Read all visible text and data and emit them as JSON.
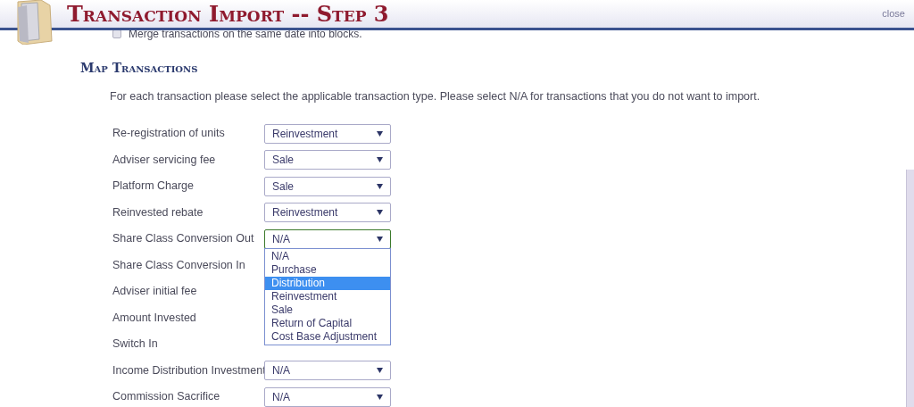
{
  "header": {
    "title": "Transaction Import -- Step 3",
    "close": "close"
  },
  "merge_option": {
    "label": "Merge transactions on the same date into blocks.",
    "checked": false
  },
  "section": {
    "heading": "Map Transactions",
    "instruction": "For each transaction please select the applicable transaction type. Please select N/A for transactions that you do not want to import."
  },
  "rows": [
    {
      "label": "Re-registration of units",
      "value": "Reinvestment",
      "open": false
    },
    {
      "label": "Adviser servicing fee",
      "value": "Sale",
      "open": false
    },
    {
      "label": "Platform Charge",
      "value": "Sale",
      "open": false
    },
    {
      "label": "Reinvested rebate",
      "value": "Reinvestment",
      "open": false
    },
    {
      "label": "Share Class Conversion Out",
      "value": "N/A",
      "open": true,
      "options": [
        {
          "label": "N/A",
          "highlighted": false
        },
        {
          "label": "Purchase",
          "highlighted": false
        },
        {
          "label": "Distribution",
          "highlighted": true
        },
        {
          "label": "Reinvestment",
          "highlighted": false
        },
        {
          "label": "Sale",
          "highlighted": false
        },
        {
          "label": "Return of Capital",
          "highlighted": false
        },
        {
          "label": "Cost Base Adjustment",
          "highlighted": false
        }
      ]
    },
    {
      "label": "Share Class Conversion In"
    },
    {
      "label": "Adviser initial fee"
    },
    {
      "label": "Amount Invested"
    },
    {
      "label": "Switch In"
    },
    {
      "label": "Income Distribution Investment",
      "value": "N/A",
      "open": false
    },
    {
      "label": "Commission Sacrifice",
      "value": "N/A",
      "open": false
    }
  ]
}
